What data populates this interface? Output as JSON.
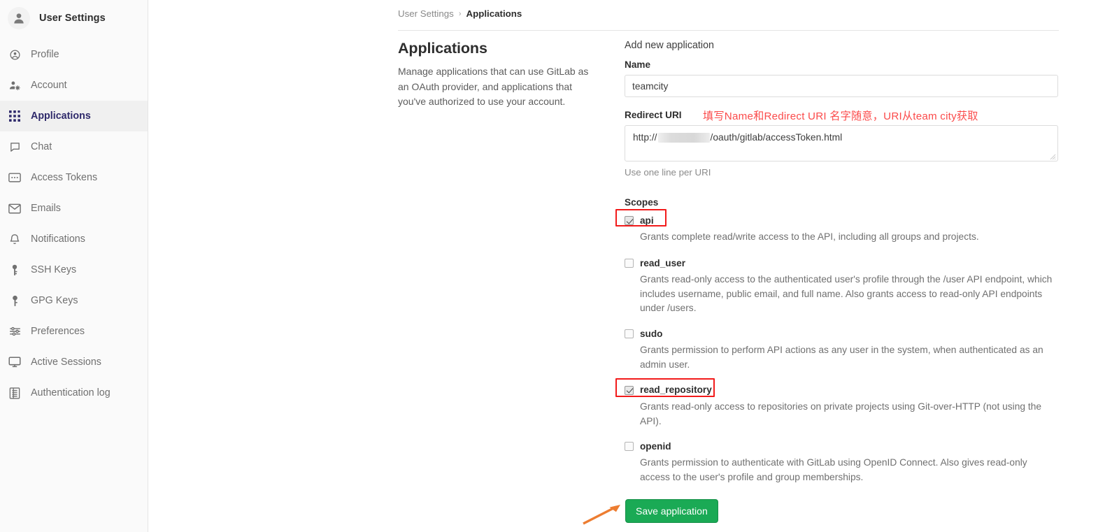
{
  "sidebar": {
    "header": {
      "title": "User Settings",
      "avatar_icon": "user-avatar-icon"
    },
    "items": [
      {
        "label": "Profile",
        "icon": "user-circle-icon",
        "active": false
      },
      {
        "label": "Account",
        "icon": "user-gear-icon",
        "active": false
      },
      {
        "label": "Applications",
        "icon": "grid-apps-icon",
        "active": true
      },
      {
        "label": "Chat",
        "icon": "chat-bubble-icon",
        "active": false
      },
      {
        "label": "Access Tokens",
        "icon": "token-card-icon",
        "active": false
      },
      {
        "label": "Emails",
        "icon": "envelope-icon",
        "active": false
      },
      {
        "label": "Notifications",
        "icon": "bell-icon",
        "active": false
      },
      {
        "label": "SSH Keys",
        "icon": "key-icon",
        "active": false
      },
      {
        "label": "GPG Keys",
        "icon": "key-icon",
        "active": false
      },
      {
        "label": "Preferences",
        "icon": "sliders-icon",
        "active": false
      },
      {
        "label": "Active Sessions",
        "icon": "monitor-icon",
        "active": false
      },
      {
        "label": "Authentication log",
        "icon": "list-log-icon",
        "active": false
      }
    ]
  },
  "breadcrumb": {
    "root": "User Settings",
    "separator": "›",
    "current": "Applications"
  },
  "description": {
    "title": "Applications",
    "body": "Manage applications that can use GitLab as an OAuth provider, and applications that you've authorized to use your account."
  },
  "form": {
    "heading": "Add new application",
    "name_label": "Name",
    "name_value": "teamcity",
    "name_placeholder": "",
    "redirect_label": "Redirect URI",
    "redirect_prefix": "http://",
    "redirect_suffix": "/oauth/gitlab/accessToken.html",
    "redirect_hint": "Use one line per URI",
    "annotation": "填写Name和Redirect URI 名字随意，URI从team city获取",
    "annotation_color": "#fb4b4b",
    "scopes_label": "Scopes",
    "scopes": [
      {
        "name": "api",
        "checked": true,
        "highlighted": true,
        "description": "Grants complete read/write access to the API, including all groups and projects."
      },
      {
        "name": "read_user",
        "checked": false,
        "highlighted": false,
        "description": "Grants read-only access to the authenticated user's profile through the /user API endpoint, which includes username, public email, and full name. Also grants access to read-only API endpoints under /users."
      },
      {
        "name": "sudo",
        "checked": false,
        "highlighted": false,
        "description": "Grants permission to perform API actions as any user in the system, when authenticated as an admin user."
      },
      {
        "name": "read_repository",
        "checked": true,
        "highlighted": true,
        "description": "Grants read-only access to repositories on private projects using Git-over-HTTP (not using the API)."
      },
      {
        "name": "openid",
        "checked": false,
        "highlighted": false,
        "description": "Grants permission to authenticate with GitLab using OpenID Connect. Also gives read-only access to the user's profile and group memberships."
      }
    ],
    "save_label": "Save application"
  },
  "colors": {
    "save_button_green": "#1aaa55",
    "highlight_red": "#f21b1b",
    "annotation_red": "#fb4b4b",
    "arrow_orange": "#ed7d31",
    "sidebar_bg": "#fafafa",
    "active_item_bg": "#f0f0f0",
    "active_item_text": "#2f2a6b"
  }
}
